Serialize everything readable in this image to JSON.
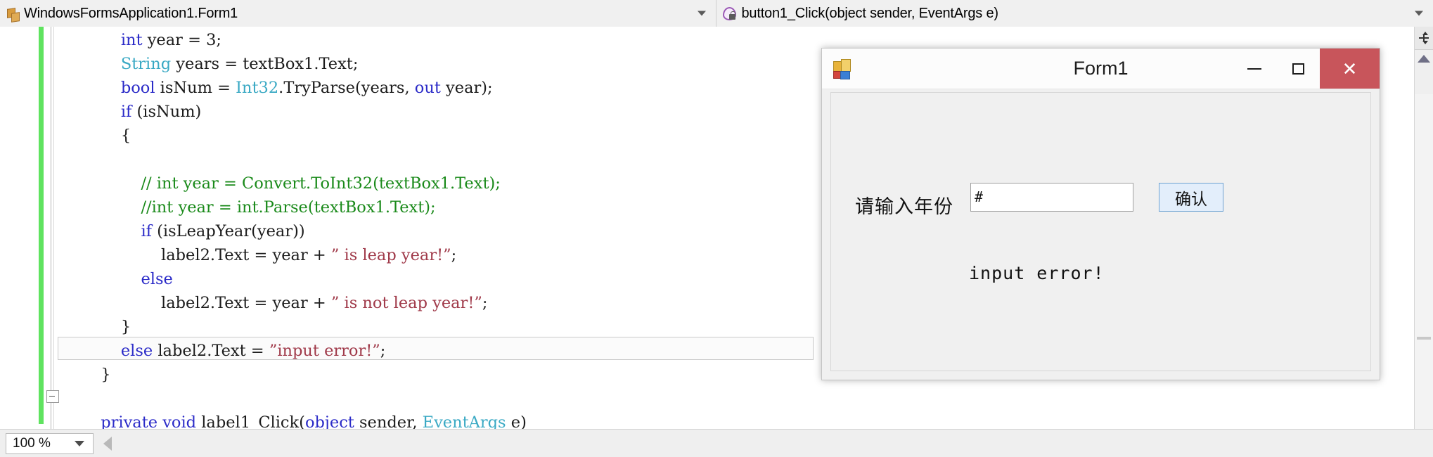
{
  "navbar": {
    "class_combo": {
      "icon": "class-icon",
      "value": "WindowsFormsApplication1.Form1",
      "arrow_icon": "chevron-down-icon"
    },
    "member_combo": {
      "icon": "method-private-icon",
      "value": "button1_Click(object sender, EventArgs e)",
      "arrow_icon": "chevron-down-icon"
    }
  },
  "editor": {
    "lines": [
      [
        {
          "t": "            ",
          "c": "pl"
        },
        {
          "t": "int",
          "c": "kw"
        },
        {
          "t": " year = 3;",
          "c": "pl"
        }
      ],
      [
        {
          "t": "            ",
          "c": "pl"
        },
        {
          "t": "String",
          "c": "typ"
        },
        {
          "t": " years = textBox1.Text;",
          "c": "pl"
        }
      ],
      [
        {
          "t": "            ",
          "c": "pl"
        },
        {
          "t": "bool",
          "c": "kw"
        },
        {
          "t": " isNum = ",
          "c": "pl"
        },
        {
          "t": "Int32",
          "c": "typ"
        },
        {
          "t": ".TryParse(years, ",
          "c": "pl"
        },
        {
          "t": "out",
          "c": "kw"
        },
        {
          "t": " year);",
          "c": "pl"
        }
      ],
      [
        {
          "t": "            ",
          "c": "pl"
        },
        {
          "t": "if",
          "c": "kw"
        },
        {
          "t": " (isNum)",
          "c": "pl"
        }
      ],
      [
        {
          "t": "            {",
          "c": "pl"
        }
      ],
      [
        {
          "t": "",
          "c": "pl"
        }
      ],
      [
        {
          "t": "                ",
          "c": "pl"
        },
        {
          "t": "// int year = Convert.ToInt32(textBox1.Text);",
          "c": "cm"
        }
      ],
      [
        {
          "t": "                ",
          "c": "pl"
        },
        {
          "t": "//int year = int.Parse(textBox1.Text);",
          "c": "cm"
        }
      ],
      [
        {
          "t": "                ",
          "c": "pl"
        },
        {
          "t": "if",
          "c": "kw"
        },
        {
          "t": " (isLeapYear(year))",
          "c": "pl"
        }
      ],
      [
        {
          "t": "                    label2.Text = year + ",
          "c": "pl"
        },
        {
          "t": "” is leap year!”",
          "c": "str"
        },
        {
          "t": ";",
          "c": "pl"
        }
      ],
      [
        {
          "t": "                ",
          "c": "pl"
        },
        {
          "t": "else",
          "c": "kw"
        }
      ],
      [
        {
          "t": "                    label2.Text = year + ",
          "c": "pl"
        },
        {
          "t": "” is not leap year!”",
          "c": "str"
        },
        {
          "t": ";",
          "c": "pl"
        }
      ],
      [
        {
          "t": "            }",
          "c": "pl"
        }
      ],
      [
        {
          "t": "            ",
          "c": "pl"
        },
        {
          "t": "else",
          "c": "kw"
        },
        {
          "t": " label2.Text = ",
          "c": "pl"
        },
        {
          "t": "”input error!”",
          "c": "str"
        },
        {
          "t": ";",
          "c": "pl"
        }
      ],
      [
        {
          "t": "        }",
          "c": "pl"
        }
      ],
      [
        {
          "t": "",
          "c": "pl"
        }
      ],
      [
        {
          "t": "        ",
          "c": "pl"
        },
        {
          "t": "private",
          "c": "kw"
        },
        {
          "t": " ",
          "c": "pl"
        },
        {
          "t": "void",
          "c": "kw"
        },
        {
          "t": " label1_Click(",
          "c": "pl"
        },
        {
          "t": "object",
          "c": "kw"
        },
        {
          "t": " sender, ",
          "c": "pl"
        },
        {
          "t": "EventArgs",
          "c": "typ"
        },
        {
          "t": " e)",
          "c": "pl"
        }
      ]
    ],
    "highlighted_line_index": 13,
    "change_bar_color": "#5fe35f"
  },
  "right_rail": {
    "split_button_icon": "split-editor-icon",
    "scroll_up_icon": "scroll-up-arrow-icon"
  },
  "statusbar": {
    "zoom_value": "100 %",
    "zoom_arrow_icon": "chevron-down-icon",
    "hscroll_left_icon": "scroll-left-arrow-icon"
  },
  "form_window": {
    "icon": "windows-forms-app-icon",
    "title": "Form1",
    "minimize_icon": "minimize-icon",
    "maximize_icon": "maximize-icon",
    "close_icon": "close-icon",
    "close_color": "#c8555b",
    "label": "请输入年份",
    "input_value": "#",
    "button_label": "确认",
    "result_text": "input error!"
  }
}
